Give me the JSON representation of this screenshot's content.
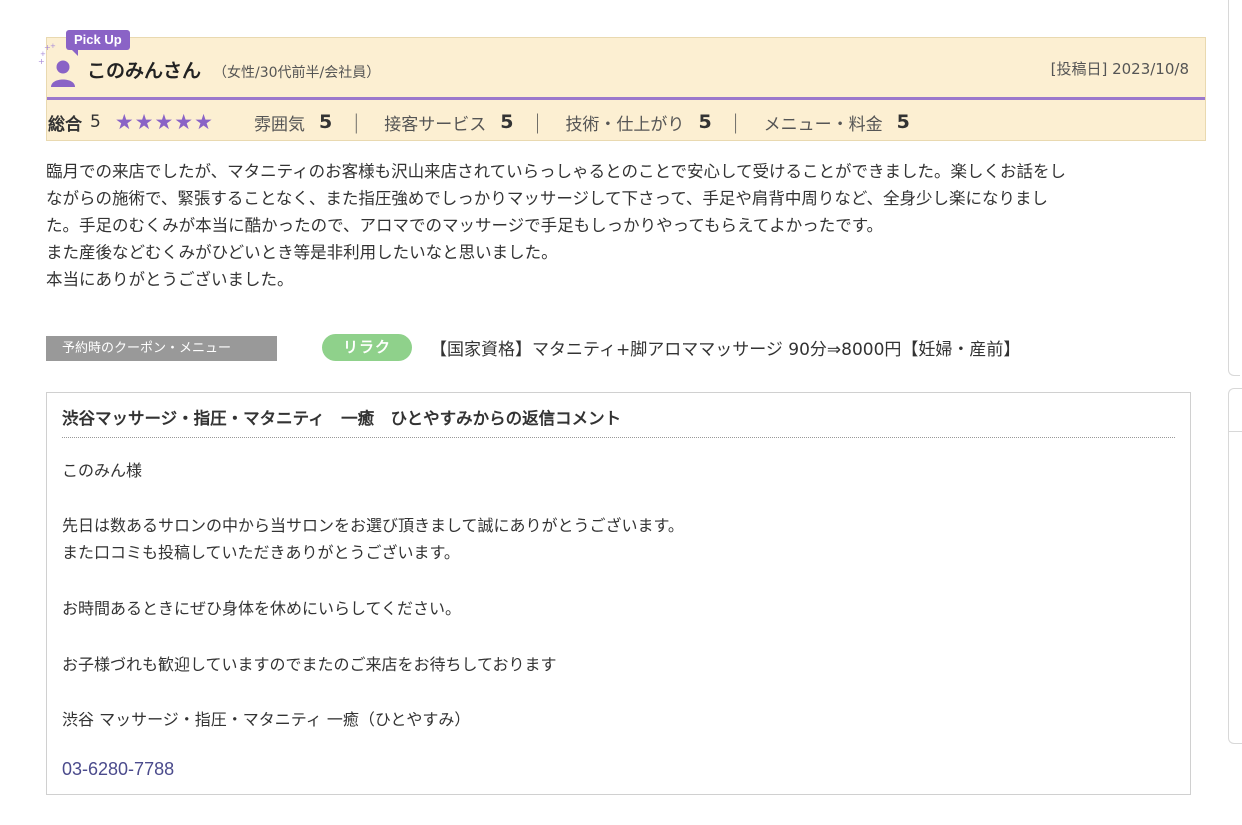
{
  "review": {
    "badge": "Pick Up",
    "reviewer_name": "このみんさん",
    "reviewer_meta": "（女性/30代前半/会社員）",
    "post_date": "[投稿日] 2023/10/8",
    "overall_label": "総合",
    "overall_score": "5",
    "stars": "★★★★★",
    "ratings": [
      {
        "label": "雰囲気",
        "value": "5"
      },
      {
        "label": "接客サービス",
        "value": "5"
      },
      {
        "label": "技術・仕上がり",
        "value": "5"
      },
      {
        "label": "メニュー・料金",
        "value": "5"
      }
    ],
    "separator": "｜",
    "body_lines": [
      "臨月での来店でしたが、マタニティのお客様も沢山来店されていらっしゃるとのことで安心して受けることができました。楽しくお話をし",
      "ながらの施術で、緊張することなく、また指圧強めでしっかりマッサージして下さって、手足や肩背中周りなど、全身少し楽になりまし",
      "た。手足のむくみが本当に酷かったので、アロマでのマッサージで手足もしっかりやってもらえてよかったです。",
      "また産後などむくみがひどいとき等是非利用したいなと思いました。",
      "本当にありがとうございました。"
    ]
  },
  "coupon": {
    "label": "予約時のクーポン・メニュー",
    "tag": "リラク",
    "name": "【国家資格】マタニティ+脚アロママッサージ 90分⇒8000円【妊婦・産前】"
  },
  "reply": {
    "title": "渋谷マッサージ・指圧・マタニティ　一癒　ひとやすみからの返信コメント",
    "lines": [
      "このみん様",
      "先日は数あるサロンの中から当サロンをお選び頂きまして誠にありがとうございます。",
      "また口コミも投稿していただきありがとうございます。",
      "お時間あるときにぜひ身体を休めにいらしてください。",
      "お子様づれも歓迎していますのでまたのご来店をお待ちしております",
      "渋谷 マッサージ・指圧・マタニティ 一癒（ひとやすみ）"
    ],
    "phone": "03-6280-7788"
  },
  "colors": {
    "header_bg": "#fcefd2",
    "accent_purple": "#8a63c6",
    "coupon_tag_green": "#8fd18b",
    "phone_link": "#4b4b8c"
  },
  "icons": [
    "sparkle-icon",
    "user-icon"
  ]
}
